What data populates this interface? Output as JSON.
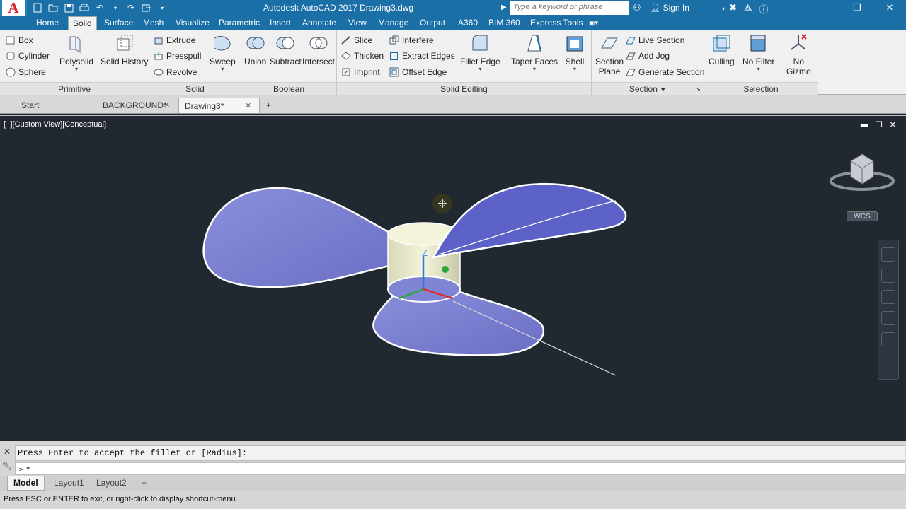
{
  "titlebar": {
    "app_letter": "A",
    "title": "Autodesk AutoCAD 2017    Drawing3.dwg",
    "search_placeholder": "Type a keyword or phrase",
    "signin": "Sign In",
    "win_min": "—",
    "win_max": "❐",
    "win_close": "✕"
  },
  "ribbon_tabs": [
    "Home",
    "Solid",
    "Surface",
    "Mesh",
    "Visualize",
    "Parametric",
    "Insert",
    "Annotate",
    "View",
    "Manage",
    "Output",
    "A360",
    "BIM 360",
    "Express Tools"
  ],
  "ribbon": {
    "primitive": {
      "title": "Primitive",
      "box": "Box",
      "cylinder": "Cylinder",
      "sphere": "Sphere",
      "polysolid": "Polysolid",
      "solid_history": "Solid History"
    },
    "solid": {
      "title": "Solid",
      "extrude": "Extrude",
      "presspull": "Presspull",
      "revolve": "Revolve",
      "sweep": "Sweep"
    },
    "boolean": {
      "title": "Boolean",
      "union": "Union",
      "subtract": "Subtract",
      "intersect": "Intersect"
    },
    "solid_editing": {
      "title": "Solid Editing",
      "slice": "Slice",
      "thicken": "Thicken",
      "imprint": "Imprint",
      "interfere": "Interfere",
      "extract_edges": "Extract Edges",
      "offset_edge": "Offset Edge",
      "fillet_edge": "Fillet Edge",
      "taper_faces": "Taper Faces",
      "shell": "Shell"
    },
    "section": {
      "title": "Section",
      "section_plane_1": "Section",
      "section_plane_2": "Plane",
      "live_section": "Live Section",
      "add_jog": "Add Jog",
      "generate_section": "Generate Section"
    },
    "selection": {
      "title": "Selection",
      "culling": "Culling",
      "no_filter": "No Filter",
      "no_gizmo_1": "No",
      "no_gizmo_2": "Gizmo"
    }
  },
  "doc_tabs": {
    "start": "Start",
    "background": "BACKGROUND*",
    "drawing3": "Drawing3*",
    "new": "+"
  },
  "viewport": {
    "label": "[−][Custom View][Conceptual]",
    "wcs": "WCS",
    "axis_z": "Z"
  },
  "command": {
    "history": "Press Enter to accept the fillet or [Radius]:"
  },
  "layout_tabs": {
    "model": "Model",
    "layout1": "Layout1",
    "layout2": "Layout2",
    "add": "+"
  },
  "status": "Press ESC or ENTER to exit, or right-click to display shortcut-menu.",
  "colors": {
    "titlebar": "#1a6fa6",
    "viewport_bg": "#212830",
    "blade_fill": "#7a7fd0",
    "hub_fill": "#e8e8c8",
    "accent": "#d6242a"
  }
}
